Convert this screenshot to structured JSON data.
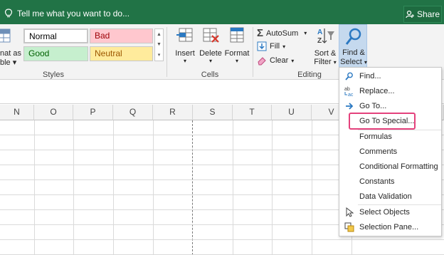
{
  "titlebar": {
    "tell_me": "Tell me what you want to do...",
    "share": "Share"
  },
  "ribbon": {
    "format_as_table_line1": "nat as",
    "format_as_table_line2": "ble ▾",
    "styles": {
      "normal": "Normal",
      "bad": "Bad",
      "good": "Good",
      "neutral": "Neutral",
      "group_label": "Styles"
    },
    "cells": {
      "insert": "Insert",
      "delete": "Delete",
      "format": "Format",
      "group_label": "Cells"
    },
    "editing": {
      "autosum": "AutoSum",
      "fill": "Fill",
      "clear": "Clear",
      "sort_filter_line1": "Sort &",
      "sort_filter_line2": "Filter",
      "find_select_line1": "Find &",
      "find_select_line2": "Select",
      "group_label": "Editing"
    }
  },
  "grid": {
    "columns": [
      "N",
      "O",
      "P",
      "Q",
      "R",
      "S",
      "T",
      "U",
      "V"
    ]
  },
  "menu": {
    "items": [
      {
        "label": "Find...",
        "icon": "magnifier-icon"
      },
      {
        "label": "Replace...",
        "icon": "replace-icon"
      },
      {
        "label": "Go To...",
        "icon": "arrow-right-icon"
      },
      {
        "label": "Go To Special...",
        "icon": ""
      },
      {
        "label": "Formulas",
        "icon": ""
      },
      {
        "label": "Comments",
        "icon": ""
      },
      {
        "label": "Conditional Formatting",
        "icon": ""
      },
      {
        "label": "Constants",
        "icon": ""
      },
      {
        "label": "Data Validation",
        "icon": ""
      },
      {
        "label": "Select Objects",
        "icon": "pointer-icon"
      },
      {
        "label": "Selection Pane...",
        "icon": "selection-pane-icon"
      }
    ]
  },
  "colors": {
    "title_bar": "#217346",
    "highlight": "#e4417c",
    "accent_blue": "#2b579a"
  }
}
